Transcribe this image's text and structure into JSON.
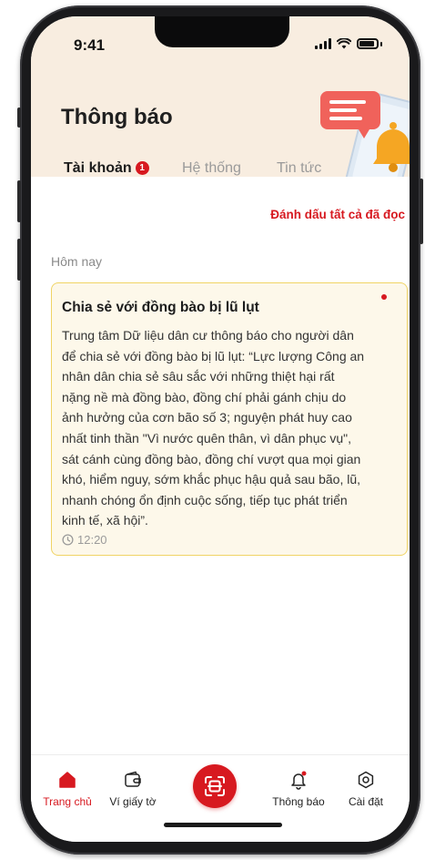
{
  "status_bar": {
    "time": "9:41"
  },
  "header": {
    "title": "Thông báo"
  },
  "tabs": [
    {
      "label": "Tài khoản",
      "badge": "1",
      "active": true
    },
    {
      "label": "Hệ thống",
      "active": false
    },
    {
      "label": "Tin tức",
      "active": false
    }
  ],
  "actions": {
    "mark_all_read": "Đánh dấu tất cả đã đọc"
  },
  "section": {
    "label": "Hôm nay"
  },
  "notification": {
    "title": "Chia sẻ với đồng bào bị lũ lụt",
    "lines": [
      "Trung tâm Dữ liệu dân cư thông báo cho người dân",
      "để chia sẻ với đồng bào bị lũ lụt: “Lực lượng Công an",
      "nhân dân chia sẻ sâu sắc với những thiệt hại rất",
      "nặng nề mà đồng bào, đồng chí phải gánh chịu do",
      "ảnh hưởng của cơn bão số 3; nguyện phát huy cao",
      "nhất tinh thần \"Vì nước quên thân, vì dân phục vụ\",",
      "sát cánh cùng đồng bào, đồng chí vượt qua mọi gian",
      "khó, hiểm nguy, sớm khắc phục hậu quả sau bão, lũ,",
      "nhanh chóng ổn định cuộc sống, tiếp tục phát triển",
      "kinh tế, xã hội”."
    ],
    "time": "12:20",
    "unread": true
  },
  "bottom_nav": {
    "home": "Trang chủ",
    "wallet": "Ví giấy tờ",
    "notifications": "Thông báo",
    "settings": "Cài đặt"
  },
  "colors": {
    "accent": "#d71920",
    "header_bg": "#f8ede0",
    "card_bg": "#fdf8ea",
    "card_border": "#f0d465"
  },
  "icons": {
    "home": "home-icon",
    "wallet": "wallet-icon",
    "scan": "scan-icon",
    "bell": "bell-icon",
    "settings": "settings-icon",
    "clock": "clock-icon"
  }
}
